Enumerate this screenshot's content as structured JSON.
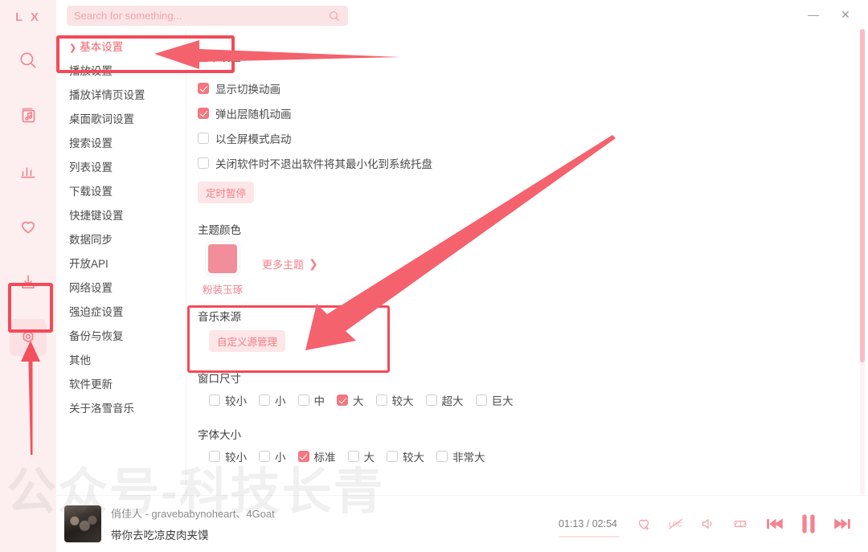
{
  "app": {
    "logo": "L X",
    "watermark": "公众号-科技长青"
  },
  "titlebar": {
    "minimize": "—",
    "close": "✕"
  },
  "search": {
    "placeholder": "Search for something...",
    "value": "",
    "icon": "search-icon"
  },
  "rail": {
    "items": [
      {
        "icon": "search-icon",
        "active": false
      },
      {
        "icon": "music-library-icon",
        "active": false
      },
      {
        "icon": "ranking-chart-icon",
        "active": false
      },
      {
        "icon": "heart-icon",
        "active": false
      },
      {
        "icon": "download-icon",
        "active": false
      },
      {
        "icon": "settings-gear-icon",
        "active": true
      }
    ]
  },
  "settings_nav": {
    "items": [
      {
        "label": "基本设置",
        "active": true
      },
      {
        "label": "播放设置",
        "active": false
      },
      {
        "label": "播放详情页设置",
        "active": false
      },
      {
        "label": "桌面歌词设置",
        "active": false
      },
      {
        "label": "搜索设置",
        "active": false
      },
      {
        "label": "列表设置",
        "active": false
      },
      {
        "label": "下载设置",
        "active": false
      },
      {
        "label": "快捷键设置",
        "active": false
      },
      {
        "label": "数据同步",
        "active": false
      },
      {
        "label": "开放API",
        "active": false
      },
      {
        "label": "网络设置",
        "active": false
      },
      {
        "label": "强迫症设置",
        "active": false
      },
      {
        "label": "备份与恢复",
        "active": false
      },
      {
        "label": "其他",
        "active": false
      },
      {
        "label": "软件更新",
        "active": false
      },
      {
        "label": "关于洛雪音乐",
        "active": false
      }
    ]
  },
  "main": {
    "section_title": "基本设置",
    "checkboxes": [
      {
        "label": "显示切换动画",
        "checked": true
      },
      {
        "label": "弹出层随机动画",
        "checked": true
      },
      {
        "label": "以全屏模式启动",
        "checked": false
      },
      {
        "label": "关闭软件时不退出软件将其最小化到系统托盘",
        "checked": false
      }
    ],
    "timer_pause_button": "定时暂停",
    "theme": {
      "title": "主题颜色",
      "current_name": "粉装玉琢",
      "current_color": "#f18e99",
      "more_label": "更多主题",
      "more_chevron": "❯"
    },
    "music_source": {
      "title": "音乐来源",
      "button": "自定义源管理"
    },
    "window_size": {
      "title": "窗口尺寸",
      "options": [
        {
          "label": "较小",
          "checked": false
        },
        {
          "label": "小",
          "checked": false
        },
        {
          "label": "中",
          "checked": false
        },
        {
          "label": "大",
          "checked": true
        },
        {
          "label": "较大",
          "checked": false
        },
        {
          "label": "超大",
          "checked": false
        },
        {
          "label": "巨大",
          "checked": false
        }
      ]
    },
    "font_size": {
      "title": "字体大小",
      "options": [
        {
          "label": "较小",
          "checked": false
        },
        {
          "label": "小",
          "checked": false
        },
        {
          "label": "标准",
          "checked": true
        },
        {
          "label": "大",
          "checked": false
        },
        {
          "label": "较大",
          "checked": false
        },
        {
          "label": "非常大",
          "checked": false
        }
      ]
    }
  },
  "player": {
    "song_title": "俏佳人 - gravebabynoheart、4Goat",
    "lyric": "带你去吃凉皮肉夹馍",
    "time": "01:13 / 02:54",
    "controls": [
      {
        "icon": "heart-plus-icon"
      },
      {
        "icon": "lrc-lyrics-icon"
      },
      {
        "icon": "volume-icon"
      },
      {
        "icon": "repeat-one-icon"
      },
      {
        "icon": "previous-track-icon"
      },
      {
        "icon": "pause-icon"
      },
      {
        "icon": "next-track-icon"
      }
    ]
  },
  "annotations": {
    "accent": "#f44a58",
    "boxes": [
      {
        "name": "settings-gear-highlight"
      },
      {
        "name": "basic-settings-highlight"
      },
      {
        "name": "music-source-highlight"
      }
    ]
  }
}
